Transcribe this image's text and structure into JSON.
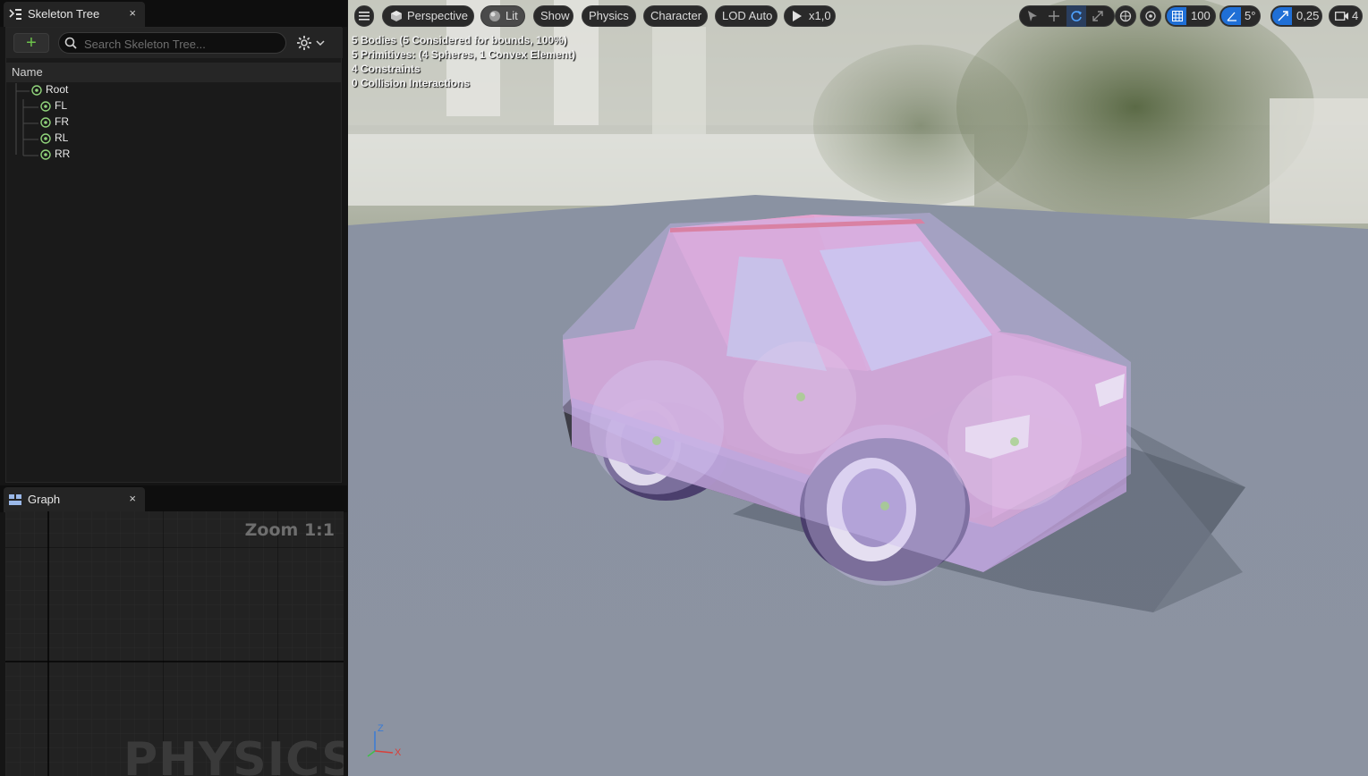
{
  "skeleton_tab": {
    "title": "Skeleton Tree",
    "close": "×"
  },
  "skeleton_toolbar": {
    "add_label": "+",
    "search_placeholder": "Search Skeleton Tree..."
  },
  "tree": {
    "header": "Name",
    "nodes": [
      {
        "label": "Root"
      },
      {
        "label": "FL"
      },
      {
        "label": "FR"
      },
      {
        "label": "RL"
      },
      {
        "label": "RR"
      }
    ]
  },
  "graph_tab": {
    "title": "Graph",
    "close": "×"
  },
  "graph": {
    "zoom": "Zoom 1:1",
    "watermark": "PHYSICS"
  },
  "viewport_toolbar": {
    "perspective": "Perspective",
    "lit": "Lit",
    "show": "Show",
    "physics": "Physics",
    "character": "Character",
    "lod": "LOD Auto",
    "play_speed": "x1,0",
    "grid_size": "100",
    "rotation_snap": "5°",
    "scale_snap": "0,25",
    "camera_speed": "4"
  },
  "stats": [
    "5 Bodies (5 Considered for bounds, 100%)",
    "5 Primitives: (4 Spheres, 1 Convex Element)",
    "4 Constraints",
    "0 Collision Interactions"
  ],
  "axes": {
    "z": "Z",
    "x": "X"
  },
  "colors": {
    "accent_blue": "#1f6fd6",
    "add_green": "#6cc24a",
    "body_pink": "#e9a2d0",
    "hull_lavender": "#c9b8ef"
  },
  "icons": [
    "skeleton-tree-icon",
    "graph-icon",
    "search-icon",
    "gear-icon",
    "menu-icon",
    "cube-icon",
    "sphere-icon",
    "play-icon",
    "select-icon",
    "translate-icon",
    "rotate-icon",
    "scale-icon",
    "grid-icon",
    "angle-icon",
    "camera-icon"
  ]
}
